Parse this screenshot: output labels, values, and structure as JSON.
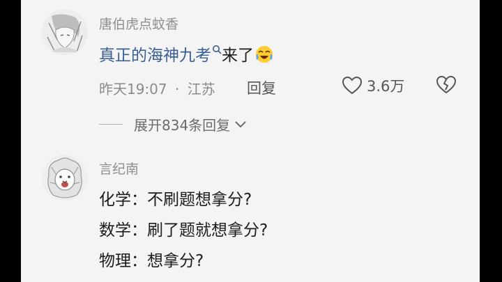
{
  "comments": [
    {
      "username": "唐伯虎点蚊香",
      "text_link": "真正的海神九考",
      "text_rest": "来了",
      "emoji": "laughing-crying-emoji",
      "time": "昨天19:07",
      "separator": "·",
      "location": "江苏",
      "reply_label": "回复",
      "likes": "3.6万",
      "expand_replies": "展开834条回复"
    },
    {
      "username": "言纪南",
      "lines": [
        "化学：不刷题想拿分?",
        "数学：刷了题就想拿分?",
        "物理：想拿分?"
      ]
    }
  ],
  "colors": {
    "link": "#3a5f95",
    "background": "#f4f4f4",
    "meta_text": "#8a8a8a"
  }
}
